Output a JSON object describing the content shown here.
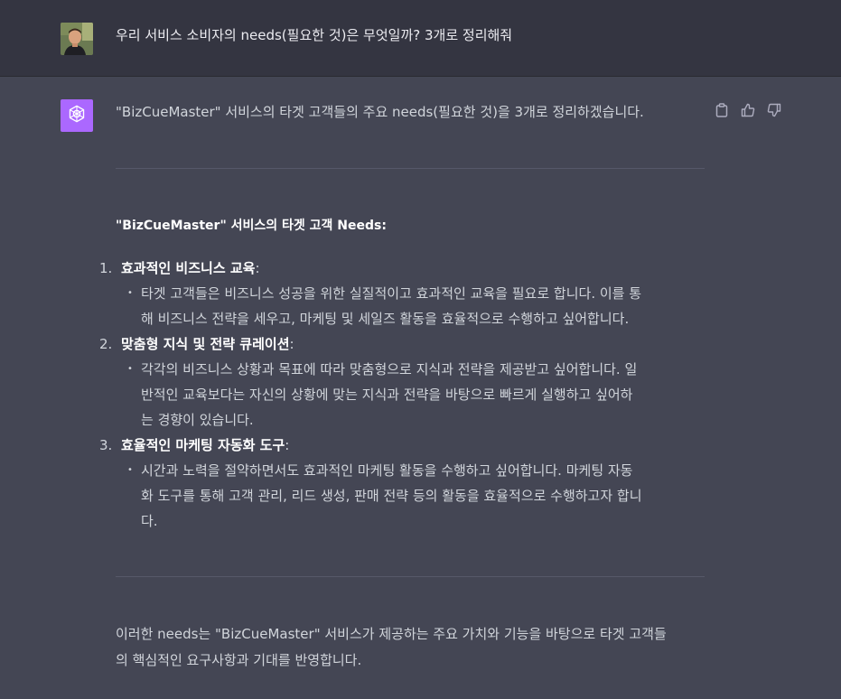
{
  "colors": {
    "user_row_bg": "#343541",
    "assistant_row_bg": "#444654",
    "assistant_avatar": "#ab68ff",
    "text": "#d1d5db",
    "heading": "#ffffff"
  },
  "user_message": {
    "avatar_icon": "user-photo-avatar",
    "text": "우리 서비스 소비자의 needs(필요한 것)은 무엇일까? 3개로 정리해줘"
  },
  "assistant_message": {
    "avatar_icon": "openai-logo-icon",
    "intro": "\"BizCueMaster\" 서비스의 타겟 고객들의 주요 needs(필요한 것)을 3개로 정리하겠습니다.",
    "actions": [
      "copy-icon",
      "thumbs-up-icon",
      "thumbs-down-icon"
    ],
    "heading": "\"BizCueMaster\" 서비스의 타겟 고객 Needs:",
    "items": [
      {
        "number": "1.",
        "title": "효과적인 비즈니스 교육",
        "colon": ":",
        "lines": [
          "타겟 고객들은 비즈니스 성공을 위한 실질적이고 효과적인 교육을 필요로 합니다. 이를 통",
          "해 비즈니스 전략을 세우고, 마케팅 및 세일즈 활동을 효율적으로 수행하고 싶어합니다."
        ]
      },
      {
        "number": "2.",
        "title": "맞춤형 지식 및 전략 큐레이션",
        "colon": ":",
        "lines": [
          "각각의 비즈니스 상황과 목표에 따라 맞춤형으로 지식과 전략을 제공받고 싶어합니다. 일",
          "반적인 교육보다는 자신의 상황에 맞는 지식과 전략을 바탕으로 빠르게 실행하고 싶어하",
          "는 경향이 있습니다."
        ]
      },
      {
        "number": "3.",
        "title": "효율적인 마케팅 자동화 도구",
        "colon": ":",
        "lines": [
          "시간과 노력을 절약하면서도 효과적인 마케팅 활동을 수행하고 싶어합니다. 마케팅 자동",
          "화 도구를 통해 고객 관리, 리드 생성, 판매 전략 등의 활동을 효율적으로 수행하고자 합니",
          "다."
        ]
      }
    ],
    "closing_lines": [
      "이러한 needs는 \"BizCueMaster\" 서비스가 제공하는 주요 가치와 기능을 바탕으로 타겟 고객들",
      "의 핵심적인 요구사항과 기대를 반영합니다."
    ]
  }
}
